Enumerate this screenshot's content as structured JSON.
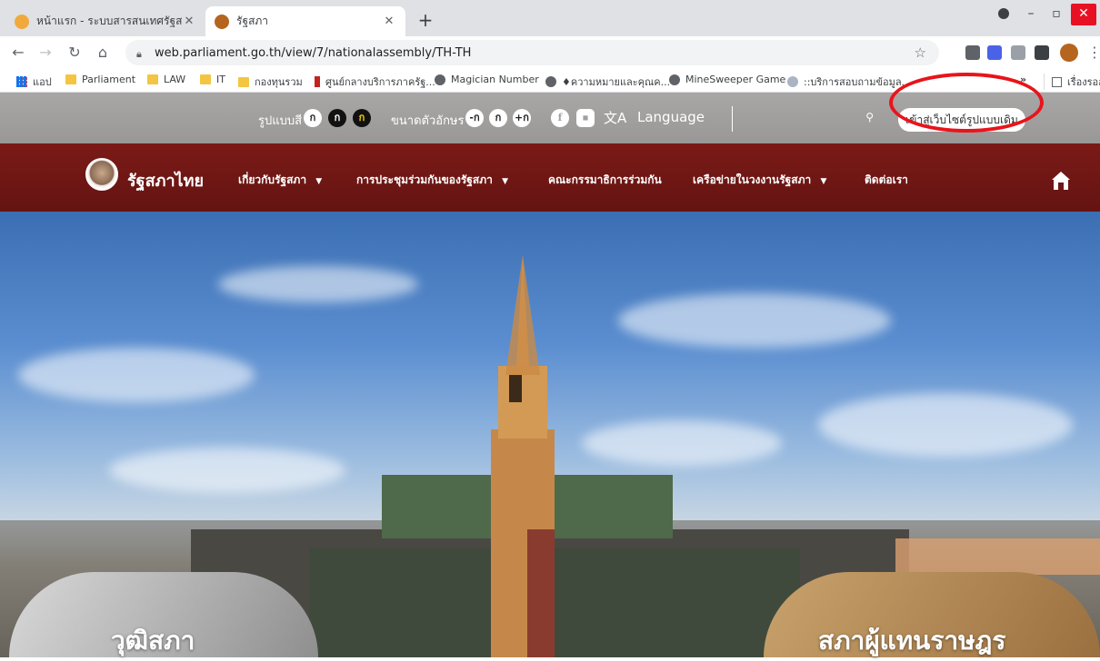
{
  "browser": {
    "tabs": [
      {
        "title": "หน้าแรก - ระบบสารสนเทศรัฐสภา",
        "active": false
      },
      {
        "title": "รัฐสภา",
        "active": true
      }
    ],
    "new_tab_glyph": "+",
    "url": "web.parliament.go.th/view/7/nationalassembly/TH-TH",
    "bookmarks": [
      {
        "label": "แอป",
        "icon": "apps-icon"
      },
      {
        "label": "Parliament",
        "icon": "folder-icon"
      },
      {
        "label": "LAW",
        "icon": "folder-icon"
      },
      {
        "label": "IT",
        "icon": "folder-icon"
      },
      {
        "label": "กองทุนรวม",
        "icon": "folder-icon"
      },
      {
        "label": "ศูนย์กลางบริการภาครัฐ...",
        "icon": "page-icon"
      },
      {
        "label": "Magician Number",
        "icon": "globe-icon"
      },
      {
        "label": "♦ความหมายและคุณค...",
        "icon": "globe-icon"
      },
      {
        "label": "MineSweeper Game",
        "icon": "globe-icon"
      },
      {
        "label": "::บริการสอบถามข้อมูล...",
        "icon": "globe-icon"
      },
      {
        "label": "เรื่องรออ่าน",
        "icon": "reading-list-icon"
      }
    ],
    "more_bookmarks": "»"
  },
  "site": {
    "util": {
      "theme_label": "รูปแบบสี",
      "theme_options": [
        "ก",
        "ก",
        "ก"
      ],
      "font_size_label": "ขนาดตัวอักษร",
      "font_size_options": [
        "-ก",
        "ก",
        "+ก"
      ],
      "language_label": "Language",
      "legacy_button": "เข้าสู่เว็บไซต์รูปแบบเดิม"
    },
    "nav": {
      "site_name": "รัฐสภาไทย",
      "items": [
        {
          "label": "เกี่ยวกับรัฐสภา",
          "dropdown": true
        },
        {
          "label": "การประชุมร่วมกันของรัฐสภา",
          "dropdown": true
        },
        {
          "label": "คณะกรรมาธิการร่วมกัน",
          "dropdown": false
        },
        {
          "label": "เครือข่ายในวงงานรัฐสภา",
          "dropdown": true
        },
        {
          "label": "ติดต่อเรา",
          "dropdown": false
        }
      ]
    },
    "hero": {
      "left_card": "วุฒิสภา",
      "right_card": "สภาผู้แทนราษฎร"
    }
  },
  "colors": {
    "nav_bg": "#6e1714",
    "util_bg": "#a3a0a0",
    "highlight_circle": "#e8141b"
  }
}
